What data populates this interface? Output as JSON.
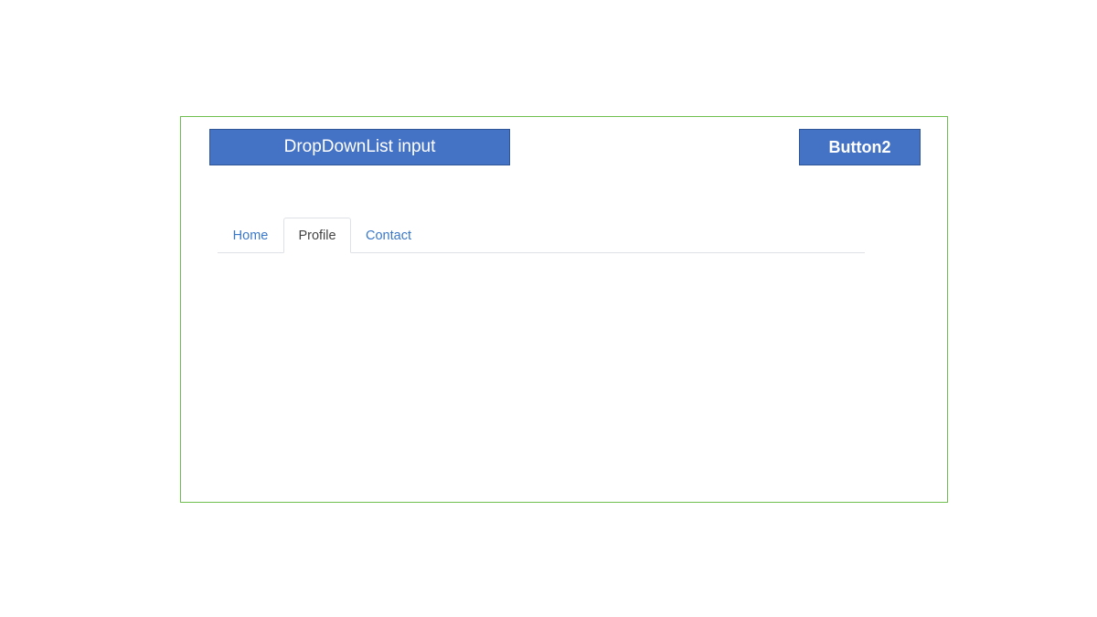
{
  "dropdown": {
    "label": "DropDownList input"
  },
  "button2": {
    "label": "Button2"
  },
  "tabs": [
    {
      "label": "Home",
      "active": false
    },
    {
      "label": "Profile",
      "active": true
    },
    {
      "label": "Contact",
      "active": false
    }
  ],
  "colors": {
    "button_bg": "#4472c4",
    "frame_border": "#6fbf4e",
    "tab_link": "#3a78c8",
    "tab_active_text": "#444444"
  }
}
